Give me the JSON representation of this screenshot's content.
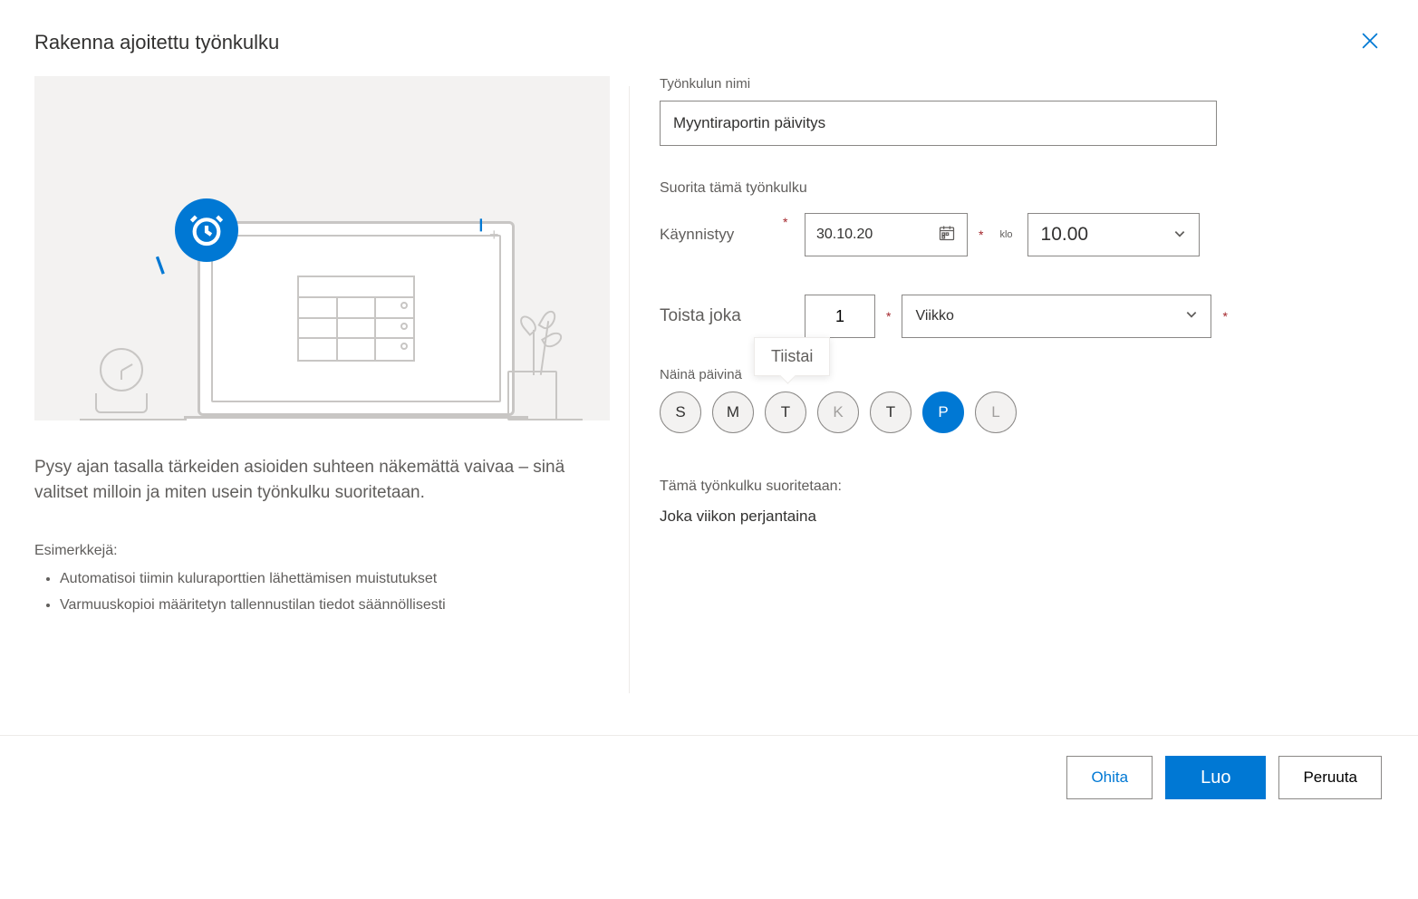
{
  "header": {
    "title": "Rakenna ajoitettu työnkulku"
  },
  "left": {
    "description": "Pysy ajan tasalla tärkeiden asioiden suhteen näkemättä vaivaa – sinä valitset milloin ja miten usein työnkulku suoritetaan.",
    "examples_label": "Esimerkkejä:",
    "examples": [
      "Automatisoi tiimin kuluraporttien lähettämisen muistutukset",
      "Varmuuskopioi määritetyn tallennustilan tiedot säännöllisesti"
    ]
  },
  "form": {
    "flow_name_label": "Työnkulun nimi",
    "flow_name_value": "Myyntiraportin päivitys",
    "run_section_label": "Suorita tämä työnkulku",
    "start_label": "Käynnistyy",
    "start_date": "30.10.20",
    "at_label": "klo",
    "start_time": "10.00",
    "repeat_label": "Toista joka",
    "repeat_count": "1",
    "repeat_unit": "Viikko",
    "days_label": "Näinä päivinä",
    "tooltip": "Tiistai",
    "days": [
      {
        "abbr": "S",
        "selected": false,
        "disabled": false
      },
      {
        "abbr": "M",
        "selected": false,
        "disabled": false
      },
      {
        "abbr": "T",
        "selected": false,
        "disabled": false
      },
      {
        "abbr": "K",
        "selected": false,
        "disabled": true
      },
      {
        "abbr": "T",
        "selected": false,
        "disabled": false
      },
      {
        "abbr": "P",
        "selected": true,
        "disabled": false
      },
      {
        "abbr": "L",
        "selected": false,
        "disabled": true
      }
    ],
    "summary_label": "Tämä työnkulku suoritetaan:",
    "summary_text": "Joka viikon perjantaina"
  },
  "footer": {
    "skip": "Ohita",
    "create": "Luo",
    "cancel": "Peruuta"
  }
}
